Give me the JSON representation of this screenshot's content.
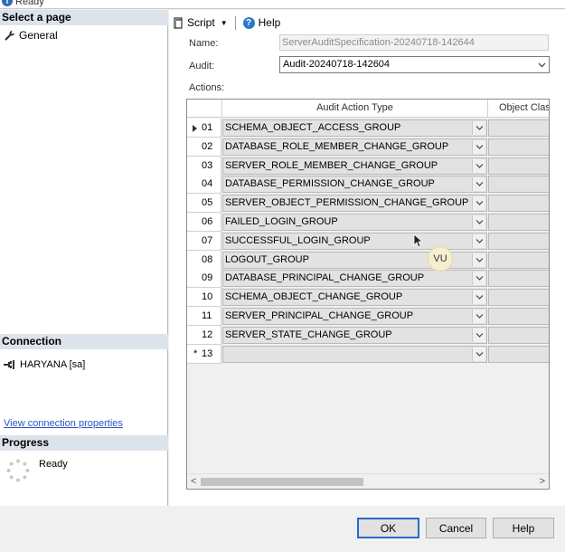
{
  "status": {
    "text": "Ready"
  },
  "left": {
    "select_page_title": "Select a page",
    "pages": [
      {
        "label": "General"
      }
    ],
    "connection_title": "Connection",
    "connection_item": "HARYANA [sa]",
    "connection_link": "View connection properties",
    "progress_title": "Progress",
    "progress_status": "Ready"
  },
  "toolbar": {
    "script_label": "Script",
    "help_label": "Help"
  },
  "form": {
    "name_label": "Name:",
    "name_value": "ServerAuditSpecification-20240718-142644",
    "audit_label": "Audit:",
    "audit_value": "Audit-20240718-142604",
    "actions_label": "Actions:"
  },
  "grid": {
    "columns": [
      "Audit Action Type",
      "Object Class"
    ],
    "rows": [
      {
        "index": "01",
        "type": "SCHEMA_OBJECT_ACCESS_GROUP"
      },
      {
        "index": "02",
        "type": "DATABASE_ROLE_MEMBER_CHANGE_GROUP"
      },
      {
        "index": "03",
        "type": "SERVER_ROLE_MEMBER_CHANGE_GROUP"
      },
      {
        "index": "04",
        "type": "DATABASE_PERMISSION_CHANGE_GROUP"
      },
      {
        "index": "05",
        "type": "SERVER_OBJECT_PERMISSION_CHANGE_GROUP"
      },
      {
        "index": "06",
        "type": "FAILED_LOGIN_GROUP"
      },
      {
        "index": "07",
        "type": "SUCCESSFUL_LOGIN_GROUP"
      },
      {
        "index": "08",
        "type": "LOGOUT_GROUP"
      },
      {
        "index": "09",
        "type": "DATABASE_PRINCIPAL_CHANGE_GROUP"
      },
      {
        "index": "10",
        "type": "SCHEMA_OBJECT_CHANGE_GROUP"
      },
      {
        "index": "11",
        "type": "SERVER_PRINCIPAL_CHANGE_GROUP"
      },
      {
        "index": "12",
        "type": "SERVER_STATE_CHANGE_GROUP"
      },
      {
        "index": "13",
        "type": ""
      }
    ],
    "new_row_marker": "*"
  },
  "overlay": {
    "badge_text": "VU"
  },
  "buttons": {
    "ok": "OK",
    "cancel": "Cancel",
    "help": "Help"
  }
}
